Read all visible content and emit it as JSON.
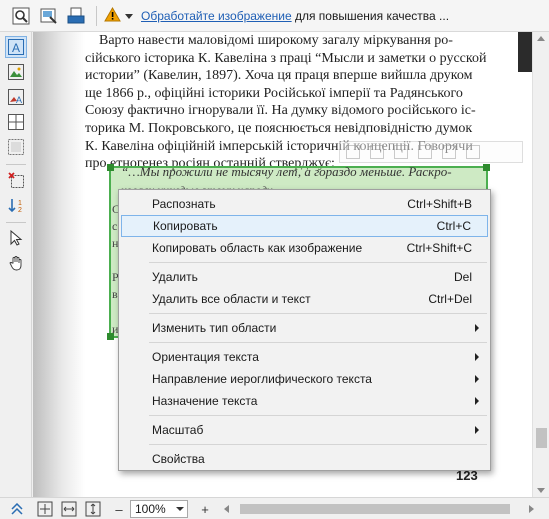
{
  "toolbar": {
    "notice_link": "Обработайте изображение",
    "notice_rest": "для повышения качества ..."
  },
  "icons": {
    "toolbar": [
      "search-doc-icon",
      "image-process-icon",
      "scanner-icon",
      "warning-icon",
      "chevron-down-icon"
    ],
    "left_tools": [
      "text-area-icon",
      "picture-area-icon",
      "text-on-picture-icon",
      "table-area-icon",
      "background-picture-icon",
      "delete-area-icon",
      "order-areas-icon",
      "select-pointer-icon",
      "hand-tool-icon"
    ]
  },
  "colors": {
    "link": "#1f5fb5",
    "selection_fill": "#7ec864",
    "selection_border": "#4caf50",
    "menu_highlight": "#e5f1fb",
    "warning": "#f0a000"
  },
  "page": {
    "lines": [
      "Варто навести маловідомі широкому загалу міркування ро-",
      "сійського історика К. Кавеліна з праці “Мысли и заметки о русской",
      "истории” (Кавелин, 1897). Хоча ця праця вперше вийшла друком",
      "ще 1866 р., офіційні історики Російської імперії та Радянського",
      "Союзу фактично ігнорували її. На думку відомого російського іс-",
      "торика М. Покровського, це пояснюється невідповідністю думок",
      "К. Кавеліна офіційній імперській історичній концепції. Говорячи",
      "про етногенез росіян останній стверджує:"
    ],
    "quote_line": "“…Мы прожили не тысячу лет, а гораздо меньше. Раскро-",
    "quote_line2": "ковали чуждые этому народу… ",
    "margin_marks": [
      "С",
      "с",
      "н",
      "Р",
      "в",
      "и"
    ],
    "page_number": "123"
  },
  "context_menu": {
    "items": [
      {
        "label": "Распознать",
        "shortcut": "Ctrl+Shift+B"
      },
      {
        "label": "Копировать",
        "shortcut": "Ctrl+C"
      },
      {
        "label": "Копировать область как изображение",
        "shortcut": "Ctrl+Shift+C"
      },
      {
        "label": "Удалить",
        "shortcut": "Del"
      },
      {
        "label": "Удалить все области и текст",
        "shortcut": "Ctrl+Del"
      },
      {
        "label": "Изменить тип области",
        "shortcut": ""
      },
      {
        "label": "Ориентация текста",
        "shortcut": ""
      },
      {
        "label": "Направление иероглифического текста",
        "shortcut": ""
      },
      {
        "label": "Назначение текста",
        "shortcut": ""
      },
      {
        "label": "Масштаб",
        "shortcut": ""
      },
      {
        "label": "Свойства",
        "shortcut": ""
      }
    ]
  },
  "zoom": {
    "value": "100%"
  }
}
